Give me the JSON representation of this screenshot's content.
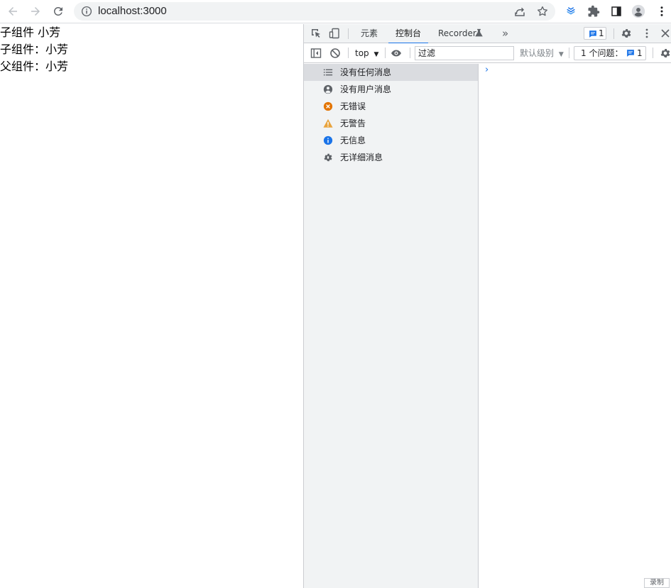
{
  "browser": {
    "url": "localhost:3000"
  },
  "page": {
    "lines": [
      "子组件 小芳",
      "子组件：小芳",
      "父组件：小芳"
    ]
  },
  "devtools": {
    "tabs": [
      {
        "label": "元素"
      },
      {
        "label": "控制台"
      },
      {
        "label": "Recorder"
      }
    ],
    "issues_badge_count": "1",
    "toolbar": {
      "context": "top",
      "filter_value": "过滤",
      "level": "默认级别",
      "issues_label": "1 个问题：",
      "issues_count": "1"
    },
    "sidebar": [
      {
        "label": "没有任何消息",
        "icon": "list-icon"
      },
      {
        "label": "没有用户消息",
        "icon": "user-icon"
      },
      {
        "label": "无错误",
        "icon": "error-icon"
      },
      {
        "label": "无警告",
        "icon": "warning-icon"
      },
      {
        "label": "无信息",
        "icon": "info-icon"
      },
      {
        "label": "无详细消息",
        "icon": "bug-icon"
      }
    ],
    "drawer_button": "录制"
  },
  "colors": {
    "accent": "#1a73e8",
    "error": "#e37400",
    "warning": "#e8a33d",
    "info": "#1a73e8"
  }
}
